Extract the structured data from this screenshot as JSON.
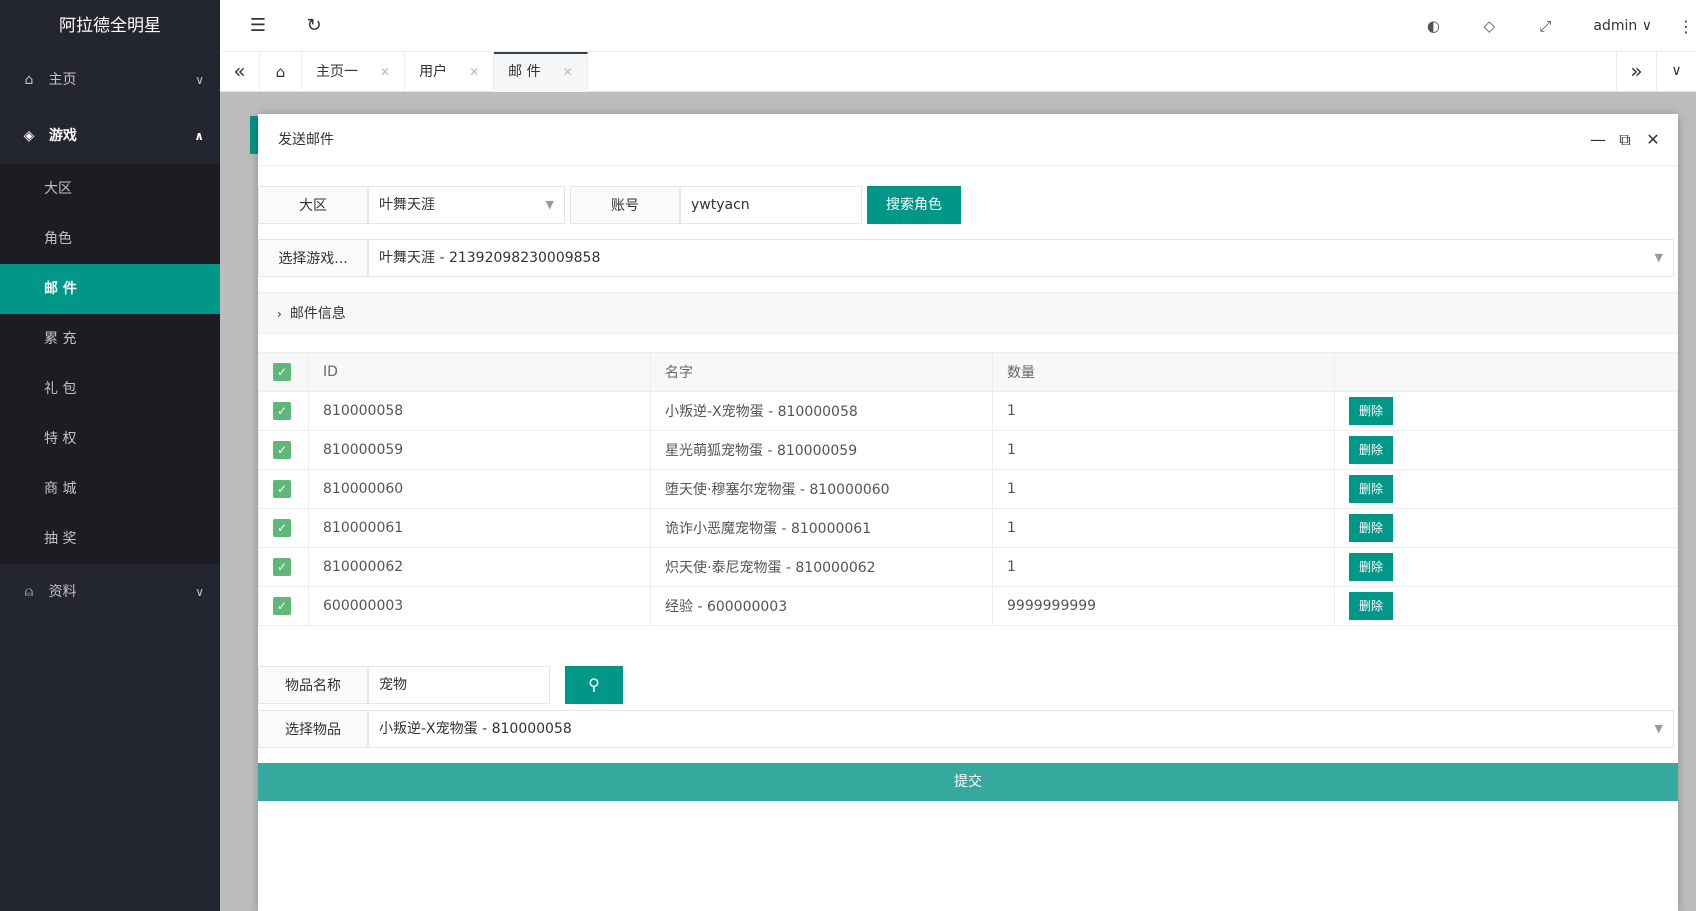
{
  "app": {
    "title": "阿拉德全明星"
  },
  "sidebar": {
    "items": [
      {
        "label": "主页",
        "icon": "home-icon"
      },
      {
        "label": "游戏",
        "icon": "diamond-icon"
      },
      {
        "label": "资料",
        "icon": "user-icon"
      }
    ],
    "sub": [
      "大区",
      "角色",
      "邮 件",
      "累 充",
      "礼 包",
      "特 权",
      "商 城",
      "抽 奖"
    ]
  },
  "header": {
    "user": "admin"
  },
  "tabs": [
    "主页一",
    "用户",
    "邮 件"
  ],
  "modal": {
    "title": "发送邮件",
    "region_label": "大区",
    "region_value": "叶舞天涯",
    "account_label": "账号",
    "account_value": "ywtyacn",
    "search_role_label": "搜索角色",
    "select_game_label": "选择游戏...",
    "select_game_value": "叶舞天涯 - 21392098230009858",
    "mail_info_label": "邮件信息",
    "table": {
      "headers": [
        "ID",
        "名字",
        "数量"
      ],
      "delete_label": "删除",
      "rows": [
        {
          "id": "810000058",
          "name": "小叛逆-X宠物蛋 - 810000058",
          "qty": "1"
        },
        {
          "id": "810000059",
          "name": "星光萌狐宠物蛋 - 810000059",
          "qty": "1"
        },
        {
          "id": "810000060",
          "name": "堕天使·穆塞尔宠物蛋 - 810000060",
          "qty": "1"
        },
        {
          "id": "810000061",
          "name": "诡诈小恶魔宠物蛋 - 810000061",
          "qty": "1"
        },
        {
          "id": "810000062",
          "name": "炽天使·泰尼宠物蛋 - 810000062",
          "qty": "1"
        },
        {
          "id": "600000003",
          "name": "经验 - 600000003",
          "qty": "9999999999"
        }
      ]
    },
    "item_name_label": "物品名称",
    "item_name_value": "宠物",
    "select_item_label": "选择物品",
    "select_item_value": "小叛逆-X宠物蛋 - 810000058",
    "submit_label": "提交"
  },
  "colors": {
    "accent": "#009688",
    "sidebar": "#23262e",
    "checkbox": "#5fb878"
  }
}
